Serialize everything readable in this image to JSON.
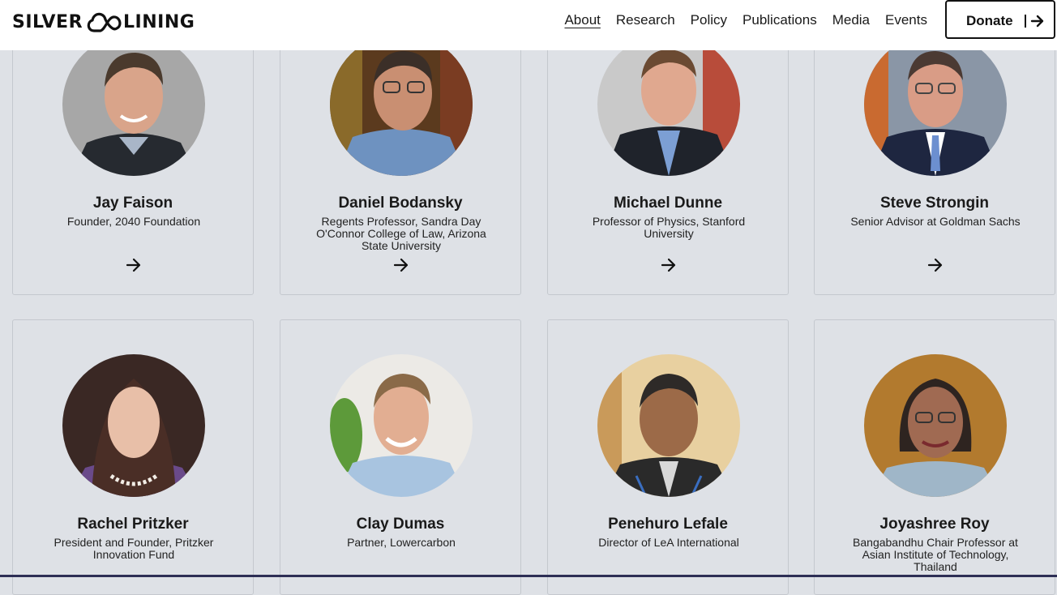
{
  "brand": {
    "left_text": "SILVER",
    "right_text": "LINING",
    "logo_icon": "infinity-cloud-icon"
  },
  "nav": {
    "items": [
      {
        "label": "About",
        "active": true
      },
      {
        "label": "Research"
      },
      {
        "label": "Policy"
      },
      {
        "label": "Publications"
      },
      {
        "label": "Media"
      },
      {
        "label": "Events"
      }
    ],
    "donate_label": "Donate",
    "donate_icon": "arrow-right-icon"
  },
  "people": [
    {
      "name": "Jay Faison",
      "role": "Founder, 2040 Foundation"
    },
    {
      "name": "Daniel Bodansky",
      "role": "Regents Professor, Sandra Day O'Connor College of Law, Arizona State University"
    },
    {
      "name": "Michael Dunne",
      "role": "Professor of Physics, Stanford University"
    },
    {
      "name": "Steve Strongin",
      "role": "Senior Advisor at Goldman Sachs"
    },
    {
      "name": "Rachel Pritzker",
      "role": "President and Founder, Pritzker Innovation Fund"
    },
    {
      "name": "Clay Dumas",
      "role": "Partner, Lowercarbon"
    },
    {
      "name": "Penehuro Lefale",
      "role": "Director of LeA International"
    },
    {
      "name": "Joyashree Roy",
      "role": "Bangabandhu Chair Professor at Asian Institute of Technology, Thailand"
    }
  ],
  "colors": {
    "page_bg": "#dee1e6",
    "header_bg": "#ffffff",
    "text": "#151515",
    "border": "#c4c8ce",
    "footer_line": "#2d2e55"
  }
}
